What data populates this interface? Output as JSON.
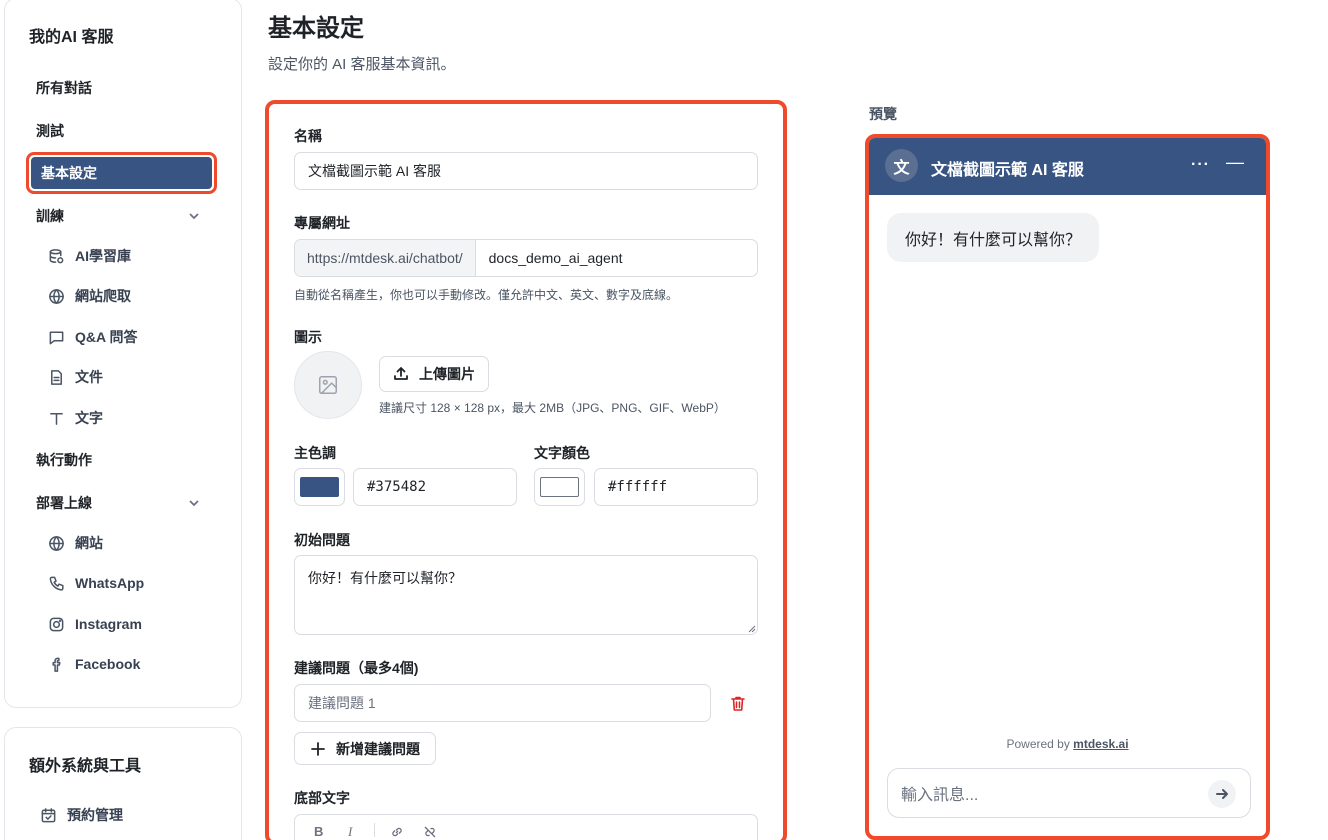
{
  "sidebar": {
    "title": "我的AI 客服",
    "items": {
      "all_conversations": "所有對話",
      "test": "測試",
      "basic_settings": "基本設定",
      "training": "訓練",
      "actions": "執行動作",
      "deploy": "部署上線"
    },
    "training_items": [
      "AI學習庫",
      "網站爬取",
      "Q&A 問答",
      "文件",
      "文字"
    ],
    "deploy_items": [
      "網站",
      "WhatsApp",
      "Instagram",
      "Facebook"
    ]
  },
  "extra": {
    "title": "額外系統與工具",
    "items": [
      "預約管理"
    ]
  },
  "page": {
    "title": "基本設定",
    "subtitle": "設定你的 AI 客服基本資訊。"
  },
  "form": {
    "name_label": "名稱",
    "name_value": "文檔截圖示範 AI 客服",
    "url_label": "專屬網址",
    "url_prefix": "https://mtdesk.ai/chatbot/",
    "url_slug": "docs_demo_ai_agent",
    "url_hint": "自動從名稱產生，你也可以手動修改。僅允許中文、英文、數字及底線。",
    "icon_label": "圖示",
    "upload_label": "上傳圖片",
    "upload_hint": "建議尺寸 128 × 128 px，最大 2MB（JPG、PNG、GIF、WebP）",
    "primary_color_label": "主色調",
    "primary_color": "#375482",
    "text_color_label": "文字顏色",
    "text_color": "#ffffff",
    "initial_question_label": "初始問題",
    "initial_question_value": "你好！有什麼可以幫你？",
    "suggested_label": "建議問題（最多4個)",
    "suggested_placeholder": "建議問題 1",
    "add_suggested": "新增建議問題",
    "footer_label": "底部文字"
  },
  "preview": {
    "label": "預覽",
    "avatar_char": "文",
    "title": "文檔截圖示範 AI 客服",
    "greeting": "你好！有什麼可以幫你？",
    "powered_prefix": "Powered by ",
    "powered_link": "mtdesk.ai",
    "input_placeholder": "輸入訊息..."
  },
  "colors": {
    "accent_highlight": "#ef4a2c",
    "brand": "#375482",
    "delete": "#dc2626"
  }
}
